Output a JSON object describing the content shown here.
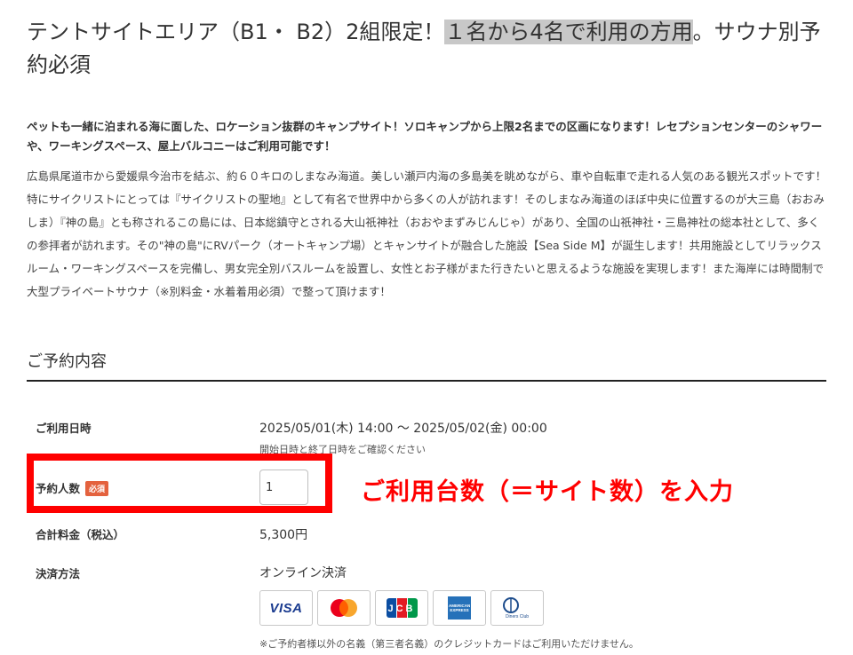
{
  "page": {
    "title_pre": "テントサイトエリア（B1・ B2）2組限定！",
    "title_highlight": "１名から4名で利用の方用",
    "title_post": "。サウナ別予約必須",
    "lead": "ペットも一緒に泊まれる海に面した、ロケーション抜群のキャンプサイト！ソロキャンプから上限2名までの区画になります！レセプションセンターのシャワーや、ワーキングスペース、屋上バルコニーはご利用可能です！",
    "description": "広島県尾道市から愛媛県今治市を結ぶ、約６０キロのしまなみ海道。美しい瀬戸内海の多島美を眺めながら、車や自転車で走れる人気のある観光スポットです！特にサイクリストにとっては『サイクリストの聖地』として有名で世界中から多くの人が訪れます！そのしまなみ海道のほぼ中央に位置するのが大三島（おおみしま）『神の島』とも称されるこの島には、日本総鎮守とされる大山祇神社（おおやまずみじんじゃ）があり、全国の山祇神社・三島神社の総本社として、多くの参拝者が訪れます。その\"神の島\"にRVパーク（オートキャンプ場）とキャンサイトが融合した施設【Sea Side M】が誕生します！共用施設としてリラックスルーム・ワーキングスペースを完備し、男女完全別バスルームを設置し、女性とお子様がまた行きたいと思えるような施設を実現します！また海岸には時間制で大型プライベートサウナ（※別料金・水着着用必須）で整って頂けます！"
  },
  "reservation": {
    "section_title": "ご予約内容",
    "date_label": "ご利用日時",
    "date_value": "2025/05/01(木) 14:00 〜 2025/05/02(金) 00:00",
    "date_note": "開始日時と終了日時をご確認ください",
    "people_label": "予約人数",
    "required_badge": "必須",
    "people_value": "1",
    "total_label": "合計料金（税込）",
    "total_value": "5,300円",
    "payment_label": "決済方法",
    "payment_value": "オンライン決済",
    "card_note": "※ご予約者様以外の名義（第三者名義）のクレジットカードはご利用いただけません。"
  },
  "cards": {
    "visa": "VISA",
    "jcb": "JCB",
    "amex": "AMERICAN EXPRESS",
    "diners": "Diners Club"
  },
  "annotation": {
    "text": "ご利用台数（＝サイト数）を入力",
    "color": "#ff0000"
  }
}
